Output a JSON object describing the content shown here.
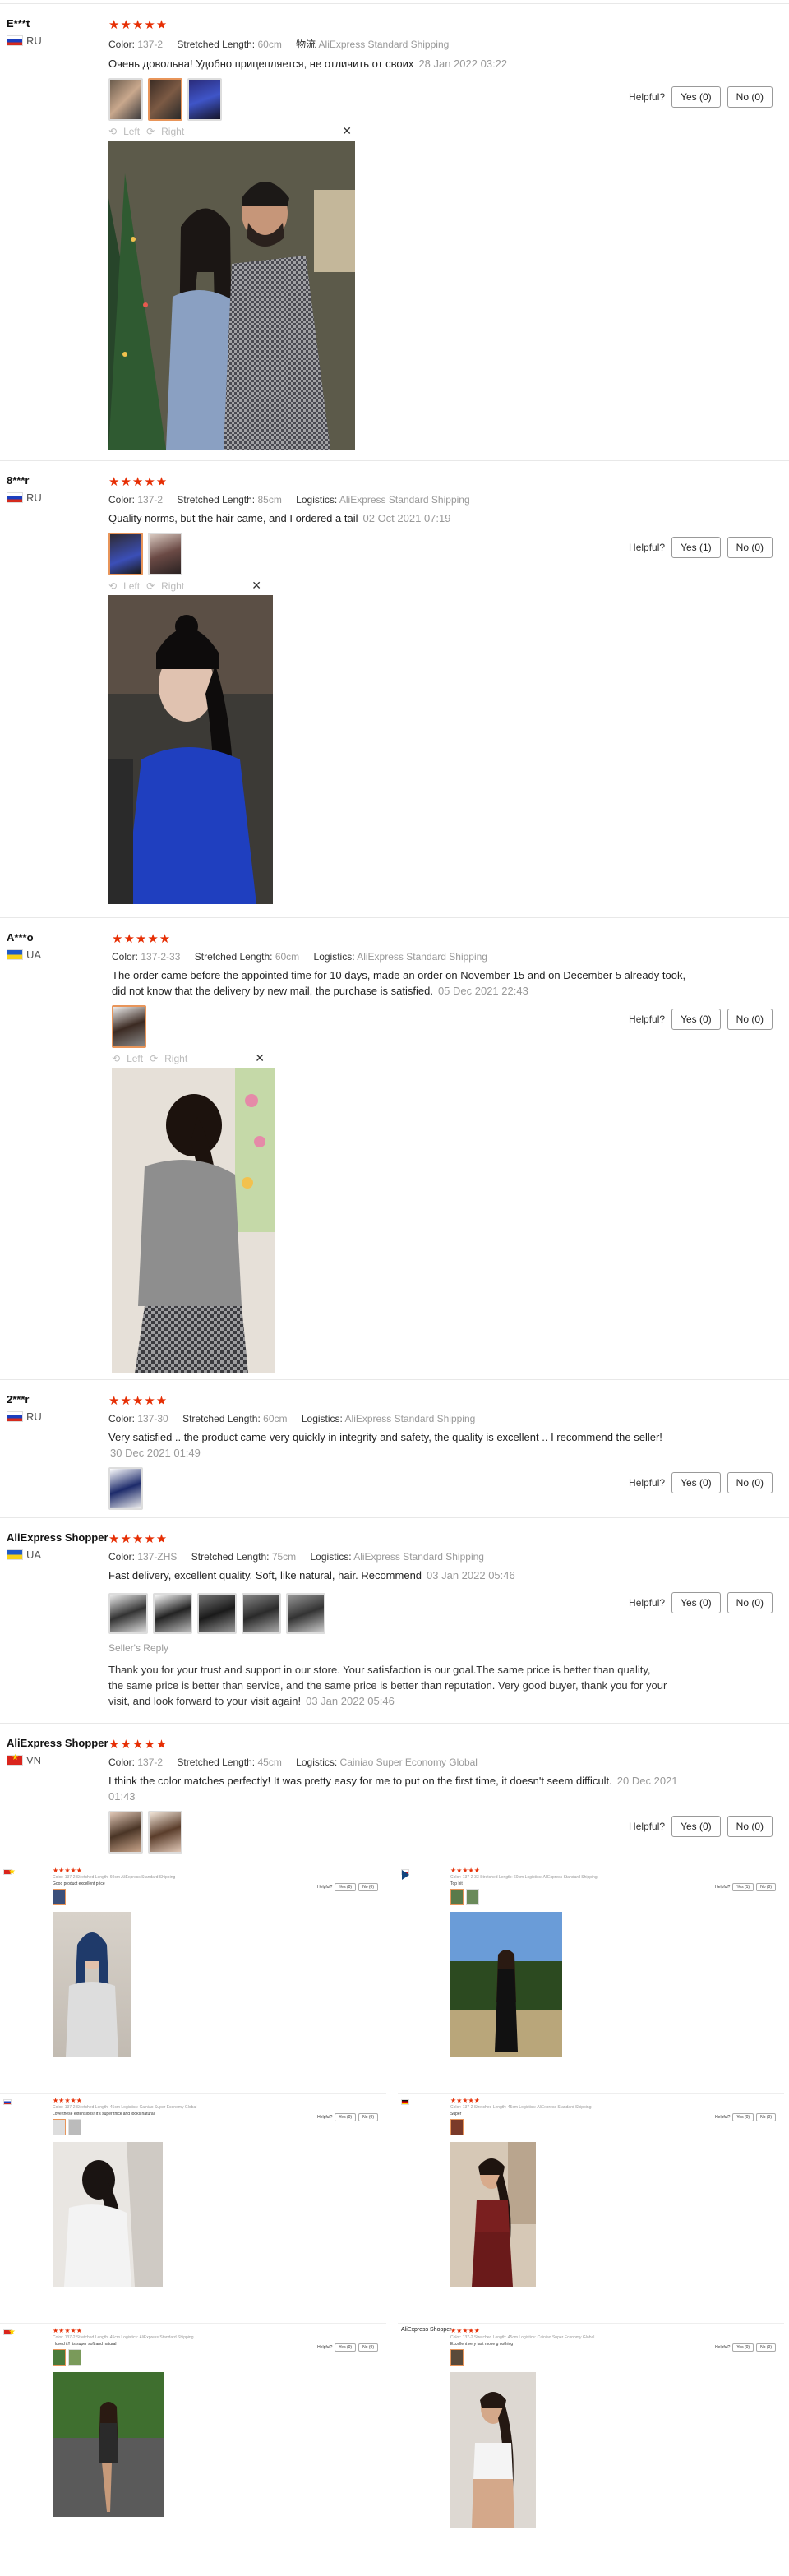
{
  "reviews": [
    {
      "user": "E***t",
      "country": "RU",
      "stars": "★★★★★",
      "color_label": "Color:",
      "color": "137-2",
      "length_label": "Stretched Length:",
      "length": "60cm",
      "shipping_label": "物流",
      "shipping": "AliExpress Standard Shipping",
      "text": "Очень довольна! Удобно прицепляется, не отличить от своих",
      "date": "28 Jan 2022 03:22",
      "helpful": "Helpful?",
      "yes": "Yes (0)",
      "no": "No (0)",
      "viewer_left": "Left",
      "viewer_right": "Right"
    },
    {
      "user": "8***r",
      "country": "RU",
      "stars": "★★★★★",
      "color_label": "Color:",
      "color": "137-2",
      "length_label": "Stretched Length:",
      "length": "85cm",
      "shipping_label": "Logistics:",
      "shipping": "AliExpress Standard Shipping",
      "text": "Quality norms, but the hair came, and I ordered a tail",
      "date": "02 Oct 2021 07:19",
      "helpful": "Helpful?",
      "yes": "Yes (1)",
      "no": "No (0)",
      "viewer_left": "Left",
      "viewer_right": "Right"
    },
    {
      "user": "A***o",
      "country": "UA",
      "stars": "★★★★★",
      "color_label": "Color:",
      "color": "137-2-33",
      "length_label": "Stretched Length:",
      "length": "60cm",
      "shipping_label": "Logistics:",
      "shipping": "AliExpress Standard Shipping",
      "text": "The order came before the appointed time for 10 days, made an order on November 15 and on December 5 already took, did not know that the delivery by new mail, the purchase is satisfied.",
      "date": "05 Dec 2021 22:43",
      "helpful": "Helpful?",
      "yes": "Yes (0)",
      "no": "No (0)",
      "viewer_left": "Left",
      "viewer_right": "Right"
    },
    {
      "user": "2***r",
      "country": "RU",
      "stars": "★★★★★",
      "color_label": "Color:",
      "color": "137-30",
      "length_label": "Stretched Length:",
      "length": "60cm",
      "shipping_label": "Logistics:",
      "shipping": "AliExpress Standard Shipping",
      "text": "Very satisfied .. the product came very quickly in integrity and safety, the quality is excellent .. I recommend the seller!",
      "date": "30 Dec 2021 01:49",
      "helpful": "Helpful?",
      "yes": "Yes (0)",
      "no": "No (0)"
    },
    {
      "user": "AliExpress Shopper",
      "country": "UA",
      "stars": "★★★★★",
      "color_label": "Color:",
      "color": "137-ZHS",
      "length_label": "Stretched Length:",
      "length": "75cm",
      "shipping_label": "Logistics:",
      "shipping": "AliExpress Standard Shipping",
      "text": "Fast delivery, excellent quality. Soft, like natural, hair. Recommend",
      "date": "03 Jan 2022 05:46",
      "helpful": "Helpful?",
      "yes": "Yes (0)",
      "no": "No (0)",
      "reply_label": "Seller's Reply",
      "reply_text": "Thank you for your trust and support in our store. Your satisfaction is our goal.The same price is better than quality, the same price is better than service, and the same price is better than reputation. Very good buyer, thank you for your visit, and look forward to your visit again!",
      "reply_date": "03 Jan 2022 05:46"
    },
    {
      "user": "AliExpress Shopper",
      "country": "VN",
      "stars": "★★★★★",
      "color_label": "Color:",
      "color": "137-2",
      "length_label": "Stretched Length:",
      "length": "45cm",
      "shipping_label": "Logistics:",
      "shipping": "Cainiao Super Economy Global",
      "text": "I think the color matches perfectly! It was pretty easy for me to put on the first time, it doesn't seem difficult.",
      "date": "20 Dec 2021 01:43",
      "helpful": "Helpful?",
      "yes": "Yes (0)",
      "no": "No (0)"
    }
  ],
  "mini_reviews": [
    {
      "stars": "★★★★★",
      "meta": "Color: 137-2  Stretched Length: 60cm  AliExpress Standard Shipping",
      "text": "Good product excellent price",
      "helpful": "Helpful?",
      "yes": "Yes (0)",
      "no": "No (0)"
    },
    {
      "stars": "★★★★★",
      "meta": "Color: 137-2-33  Stretched Length: 60cm  Logistics: AliExpress Standard Shipping",
      "text": "Top hit",
      "helpful": "Helpful?",
      "yes": "Yes (1)",
      "no": "No (0)"
    },
    {
      "stars": "★★★★★",
      "meta": "Color: 137-2  Stretched Length: 45cm  Logistics: Cainiao Super Economy Global",
      "text": "Love these extensions! It's super thick and looks natural",
      "helpful": "Helpful?",
      "yes": "Yes (0)",
      "no": "No (0)"
    },
    {
      "stars": "★★★★★",
      "meta": "Color: 137-2  Stretched Length: 45cm  Logistics: AliExpress Standard Shipping",
      "text": "Super",
      "helpful": "Helpful?",
      "yes": "Yes (0)",
      "no": "No (0)"
    },
    {
      "stars": "★★★★★",
      "meta": "Color: 137-2  Stretched Length: 45cm  Logistics: AliExpress Standard Shipping",
      "text": "I loved it!! its super soft and natural",
      "helpful": "Helpful?",
      "yes": "Yes (0)",
      "no": "No (0)"
    },
    {
      "user": "AliExpress Shopper",
      "stars": "★★★★★",
      "meta": "Color: 137-2  Stretched Length: 45cm  Logistics: Cainiao Super Economy Global",
      "text": "Excellent very fast move g nothing",
      "helpful": "Helpful?",
      "yes": "Yes (0)",
      "no": "No (0)"
    }
  ],
  "icons": {
    "rotate_left": "rotate-left-icon",
    "rotate_right": "rotate-right-icon",
    "close": "close-icon"
  }
}
